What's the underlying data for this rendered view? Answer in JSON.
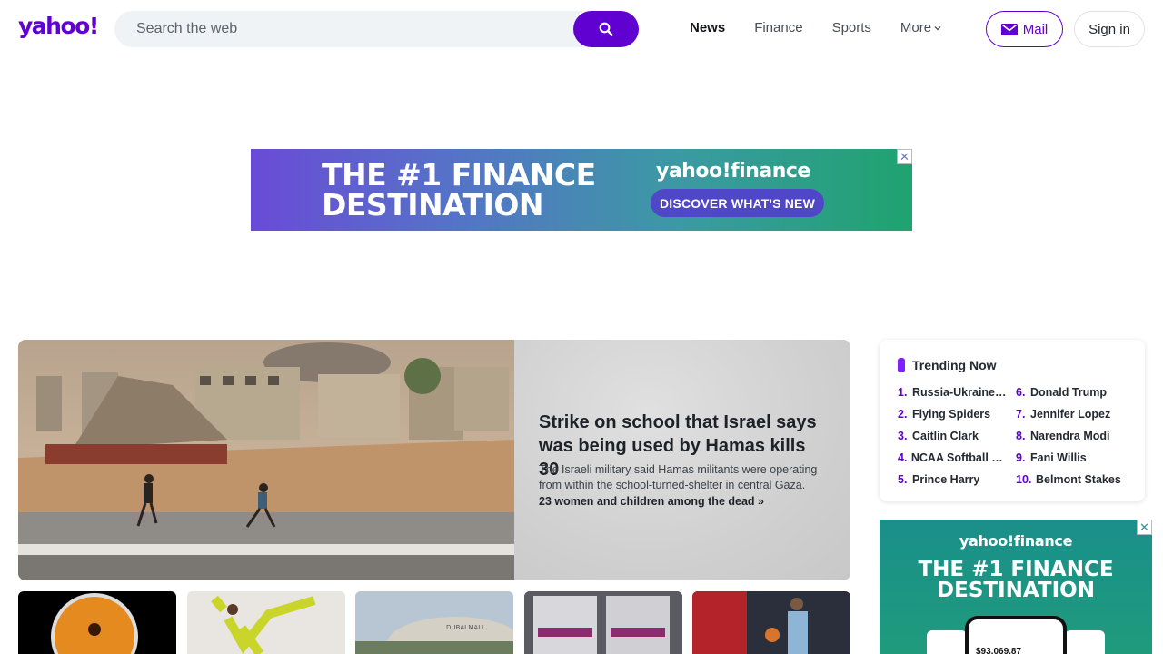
{
  "header": {
    "logo": "yahoo!",
    "search_placeholder": "Search the web",
    "nav": [
      "News",
      "Finance",
      "Sports",
      "More"
    ],
    "mail_label": "Mail",
    "signin_label": "Sign in"
  },
  "ad_banner": {
    "headline_line1": "THE #1 FINANCE",
    "headline_line2": "DESTINATION",
    "brand": "yahoo!finance",
    "cta": "DISCOVER WHAT'S NEW",
    "close": "✕"
  },
  "hero": {
    "title": "Strike on school that Israel says was being used by Hamas kills 30",
    "description": "The Israeli military said Hamas militants were operating from within the school-turned-shelter in central Gaza.",
    "link": "23 women and children among the dead »"
  },
  "trending": {
    "title": "Trending Now",
    "items": [
      {
        "num": "1.",
        "label": "Russia-Ukraine ..."
      },
      {
        "num": "2.",
        "label": "Flying Spiders"
      },
      {
        "num": "3.",
        "label": "Caitlin Clark"
      },
      {
        "num": "4.",
        "label": "NCAA Softball To..."
      },
      {
        "num": "5.",
        "label": "Prince Harry"
      },
      {
        "num": "6.",
        "label": "Donald Trump"
      },
      {
        "num": "7.",
        "label": "Jennifer Lopez"
      },
      {
        "num": "8.",
        "label": "Narendra Modi"
      },
      {
        "num": "9.",
        "label": "Fani Willis"
      },
      {
        "num": "10.",
        "label": "Belmont Stakes"
      }
    ]
  },
  "ad_side": {
    "brand": "yahoo!finance",
    "headline_line1": "THE #1 FINANCE",
    "headline_line2": "DESTINATION",
    "phone_value": "$93,069.87",
    "close": "✕"
  },
  "colors": {
    "brand": "#6001d2",
    "trending_accent": "#7e1fff"
  }
}
